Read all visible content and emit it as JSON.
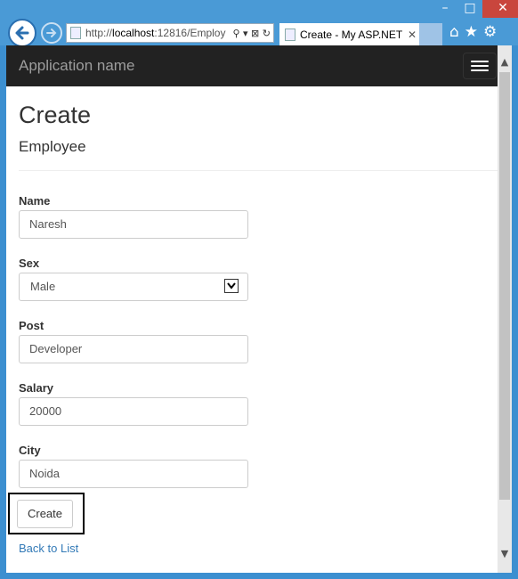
{
  "window": {
    "minimize": "–",
    "maximize": "□",
    "close": "✕"
  },
  "browser": {
    "address_prefix": "http://",
    "address_host": "localhost",
    "address_rest": ":12816/Employ",
    "address_tools": "⚲ ▾ ⊠ ↻",
    "tab_label": "Create - My ASP.NET ...",
    "tab_close": "✕",
    "home_icon": "⌂",
    "favorites_icon": "★",
    "settings_icon": "⚙"
  },
  "navbar": {
    "brand": "Application name"
  },
  "page": {
    "title": "Create",
    "subtitle": "Employee"
  },
  "form": {
    "name_label": "Name",
    "name_value": "Naresh",
    "sex_label": "Sex",
    "sex_value": "Male",
    "post_label": "Post",
    "post_value": "Developer",
    "salary_label": "Salary",
    "salary_value": "20000",
    "city_label": "City",
    "city_value": "Noida",
    "submit_label": "Create"
  },
  "links": {
    "back_to_list": "Back to List"
  },
  "colors": {
    "window_frame": "#3c8fd0",
    "navbar_bg": "#222222",
    "link": "#337ab7",
    "close_button": "#c9463d"
  }
}
